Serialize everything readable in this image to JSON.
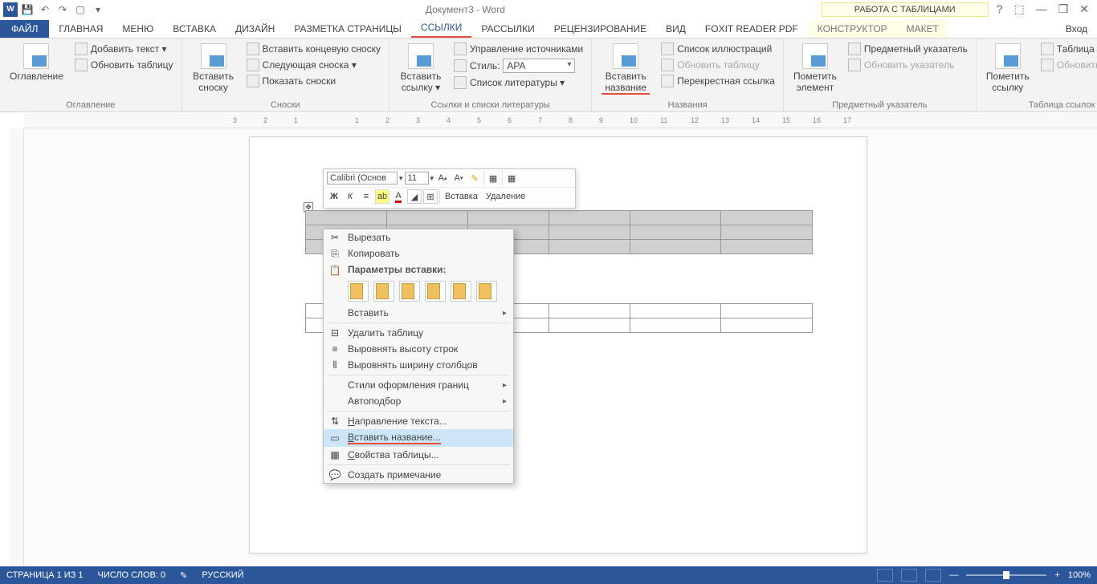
{
  "title": "Документ3 - Word",
  "tablework": "РАБОТА С ТАБЛИЦАМИ",
  "login": "Вход",
  "tabs": {
    "file": "ФАЙЛ",
    "home": "ГЛАВНАЯ",
    "menu": "Меню",
    "insert": "ВСТАВКА",
    "design": "ДИЗАЙН",
    "layout": "РАЗМЕТКА СТРАНИЦЫ",
    "refs": "ССЫЛКИ",
    "mailings": "РАССЫЛКИ",
    "review": "РЕЦЕНЗИРОВАНИЕ",
    "view": "ВИД",
    "foxit": "Foxit Reader PDF",
    "construct": "КОНСТРУКТОР",
    "maket": "МАКЕТ"
  },
  "ribbon": {
    "toc": {
      "btn": "Оглавление",
      "add": "Добавить текст ▾",
      "upd": "Обновить таблицу",
      "group": "Оглавление"
    },
    "fn": {
      "btn": "Вставить сноску",
      "end": "Вставить концевую сноску",
      "next": "Следующая сноска ▾",
      "show": "Показать сноски",
      "group": "Сноски"
    },
    "cit": {
      "btn": "Вставить ссылку ▾",
      "mgr": "Управление источниками",
      "style_lbl": "Стиль:",
      "style_val": "APA",
      "bib": "Список литературы ▾",
      "group": "Ссылки и списки литературы"
    },
    "cap": {
      "btn": "Вставить название",
      "list": "Список иллюстраций",
      "upd": "Обновить таблицу",
      "cross": "Перекрестная ссылка",
      "group": "Названия"
    },
    "idx": {
      "btn": "Пометить элемент",
      "pred": "Предметный указатель",
      "upd": "Обновить указатель",
      "group": "Предметный указатель"
    },
    "auth": {
      "btn": "Пометить ссылку",
      "tbl": "Таблица ссылок",
      "upd": "Обновить таблицу",
      "group": "Таблица ссылок"
    }
  },
  "ruler_marks": [
    "3",
    "2",
    "1",
    "",
    "1",
    "2",
    "3",
    "4",
    "5",
    "6",
    "7",
    "8",
    "9",
    "10",
    "11",
    "12",
    "13",
    "14",
    "15",
    "16",
    "17"
  ],
  "mini": {
    "font": "Calibri (Основ",
    "size": "11",
    "insert": "Вставка",
    "delete": "Удаление",
    "bold": "Ж",
    "italic": "К"
  },
  "ctx": {
    "cut": "Вырезать",
    "copy": "Копировать",
    "paste_head": "Параметры вставки:",
    "paste": "Вставить",
    "deltbl": "Удалить таблицу",
    "rowh": "Выровнять высоту строк",
    "colw": "Выровнять ширину столбцов",
    "bstyle": "Стили оформления границ",
    "autofit": "Автоподбор",
    "textdir": "Направление текста...",
    "caption": "Вставить название...",
    "props": "Свойства таблицы...",
    "comment": "Создать примечание"
  },
  "status": {
    "page": "СТРАНИЦА 1 ИЗ 1",
    "words": "ЧИСЛО СЛОВ: 0",
    "lang": "РУССКИЙ",
    "zoom": "100%"
  }
}
